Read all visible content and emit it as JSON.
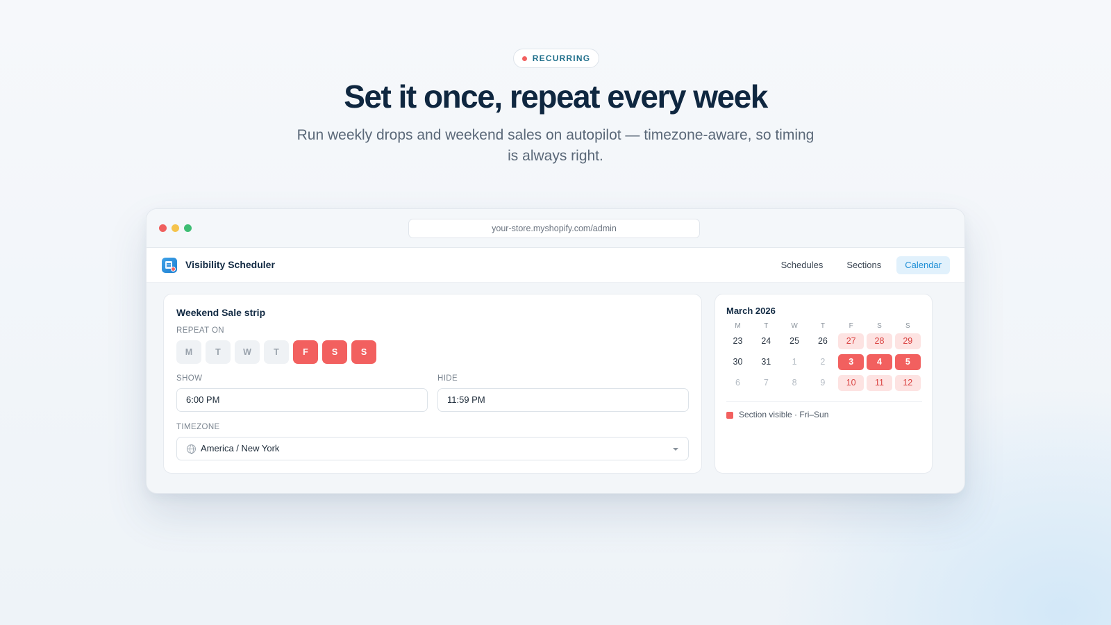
{
  "hero": {
    "badge": "RECURRING",
    "headline": "Set it once, repeat every week",
    "subtitle": "Run weekly drops and weekend sales on autopilot — timezone-aware, so timing is always right."
  },
  "browser": {
    "url": "your-store.myshopify.com/admin",
    "traffic_colors": [
      "#ef5f5e",
      "#f5c34c",
      "#3dbd73"
    ]
  },
  "app": {
    "name": "Visibility Scheduler",
    "tabs": [
      {
        "label": "Schedules",
        "active": false
      },
      {
        "label": "Sections",
        "active": false
      },
      {
        "label": "Calendar",
        "active": true
      }
    ]
  },
  "schedule": {
    "title": "Weekend Sale strip",
    "repeat_label": "REPEAT ON",
    "days": [
      {
        "label": "M",
        "on": false
      },
      {
        "label": "T",
        "on": false
      },
      {
        "label": "W",
        "on": false
      },
      {
        "label": "T",
        "on": false
      },
      {
        "label": "F",
        "on": true
      },
      {
        "label": "S",
        "on": true
      },
      {
        "label": "S",
        "on": true
      }
    ],
    "show_label": "SHOW",
    "show_value": "6:00 PM",
    "hide_label": "HIDE",
    "hide_value": "11:59 PM",
    "timezone_label": "TIMEZONE",
    "timezone_value": "America / New York"
  },
  "calendar": {
    "month": "March 2026",
    "weekdays": [
      "M",
      "T",
      "W",
      "T",
      "F",
      "S",
      "S"
    ],
    "weeks": [
      [
        {
          "d": "23",
          "s": "normal"
        },
        {
          "d": "24",
          "s": "normal"
        },
        {
          "d": "25",
          "s": "normal"
        },
        {
          "d": "26",
          "s": "normal"
        },
        {
          "d": "27",
          "s": "soft"
        },
        {
          "d": "28",
          "s": "soft"
        },
        {
          "d": "29",
          "s": "soft"
        }
      ],
      [
        {
          "d": "30",
          "s": "normal"
        },
        {
          "d": "31",
          "s": "normal"
        },
        {
          "d": "1",
          "s": "mute"
        },
        {
          "d": "2",
          "s": "mute"
        },
        {
          "d": "3",
          "s": "strong"
        },
        {
          "d": "4",
          "s": "strong"
        },
        {
          "d": "5",
          "s": "strong"
        }
      ],
      [
        {
          "d": "6",
          "s": "mute"
        },
        {
          "d": "7",
          "s": "mute"
        },
        {
          "d": "8",
          "s": "mute"
        },
        {
          "d": "9",
          "s": "mute"
        },
        {
          "d": "10",
          "s": "soft"
        },
        {
          "d": "11",
          "s": "soft"
        },
        {
          "d": "12",
          "s": "soft"
        }
      ]
    ],
    "legend": "Section visible · Fri–Sun",
    "accent": "#f2605f"
  }
}
